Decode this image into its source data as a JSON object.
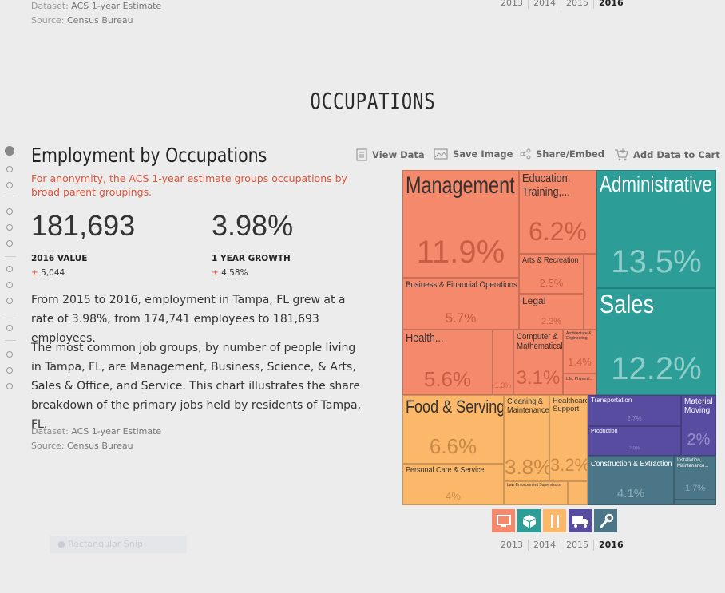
{
  "top_meta": {
    "dataset_key": "Dataset:",
    "dataset": "ACS 1-year Estimate",
    "source_key": "Source:",
    "source": "Census Bureau"
  },
  "years": [
    "2013",
    "2014",
    "2015",
    "2016"
  ],
  "years_active": "2016",
  "section_title": "OCCUPATIONS",
  "panel": {
    "title": "Employment by Occupations",
    "subtitle": "For anonymity, the ACS 1-year estimate groups occupations by broad parent groupings."
  },
  "stats": {
    "value": {
      "number": "181,693",
      "label": "2016 VALUE",
      "pm": "±",
      "moe": "5,044"
    },
    "growth": {
      "number": "3.98%",
      "label": "1 YEAR GROWTH",
      "pm": "±",
      "moe": "4.58%"
    }
  },
  "para1": "From 2015 to 2016, employment in Tampa, FL grew at a rate of 3.98%, from 174,741 employees to 181,693 employees.",
  "para2": {
    "a": "The most common job groups, by number of people living in Tampa, FL, are ",
    "l1": "Management",
    "s1": ", ",
    "l2": "Business, Science, & Arts",
    "s2": ", ",
    "l3": "Sales & Office",
    "s3": ", and ",
    "l4": "Service",
    "b": ". This chart illustrates the share breakdown of the primary jobs held by residents of Tampa, FL."
  },
  "bottom_meta": {
    "dataset_key": "Dataset:",
    "dataset": "ACS 1-year Estimate",
    "source_key": "Source:",
    "source": "Census Bureau"
  },
  "tools": {
    "view": "View Data",
    "save": "Save Image",
    "share": "Share/Embed",
    "cart": "Add Data to Cart"
  },
  "treemap": [
    {
      "label": "Management",
      "pct": "11.9%"
    },
    {
      "label": "Education, Training,...",
      "pct": "6.2%"
    },
    {
      "label": "Arts & Recreation",
      "pct": "2.5%"
    },
    {
      "label": "Legal",
      "pct": "2.2%"
    },
    {
      "label": "Business & Financial Operations",
      "pct": "5.7%"
    },
    {
      "label": "Health...",
      "pct": "5.6%"
    },
    {
      "label": "1.3%",
      "pct": ""
    },
    {
      "label": "Computer & Mathematical",
      "pct": "3.1%"
    },
    {
      "label": "Architecture & Engineering",
      "pct": "1.4%"
    },
    {
      "label": "Life, Physical...",
      "pct": ""
    },
    {
      "label": "Administrative",
      "pct": "13.5%"
    },
    {
      "label": "Sales",
      "pct": "12.2%"
    },
    {
      "label": "Food & Serving",
      "pct": "6.6%"
    },
    {
      "label": "Personal Care & Service",
      "pct": "4%"
    },
    {
      "label": "Cleaning & Maintenance",
      "pct": "3.8%"
    },
    {
      "label": "Healthcare Support",
      "pct": "3.2%"
    },
    {
      "label": "Law Enforcement Supervisors",
      "pct": ""
    },
    {
      "label": "Transportation",
      "pct": "2.7%"
    },
    {
      "label": "Production",
      "pct": "2.0%"
    },
    {
      "label": "Material Moving",
      "pct": "2%"
    },
    {
      "label": "Construction & Extraction",
      "pct": "4.1%"
    },
    {
      "label": "Installation, Maintenance...",
      "pct": "1.7%"
    }
  ],
  "colors": {
    "orange": "#f5896b",
    "teal": "#2d9d97",
    "yellow": "#fbb86b",
    "purple": "#574c9f",
    "slate": "#4b7687",
    "accent": "#e0553a"
  },
  "category_icons": [
    "monitor-icon",
    "box-icon",
    "utensils-icon",
    "truck-icon",
    "wrench-icon"
  ],
  "snip": "Rectangular Snip"
}
